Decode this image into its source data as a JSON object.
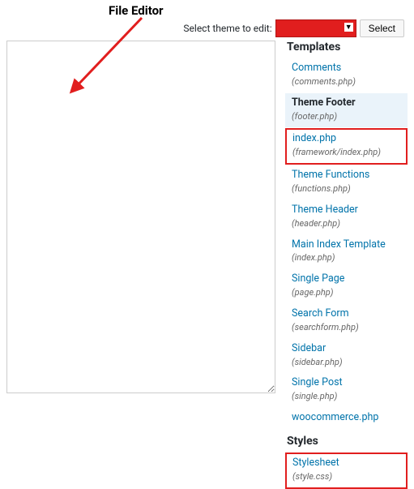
{
  "annotation": {
    "title": "File Editor"
  },
  "topbar": {
    "select_theme_label": "Select theme to edit:",
    "select_button": "Select"
  },
  "sidebar": {
    "templates_heading": "Templates",
    "styles_heading": "Styles",
    "templates": [
      {
        "name": "Comments",
        "path": "(comments.php)",
        "active": false,
        "boxed": false
      },
      {
        "name": "Theme Footer",
        "path": "(footer.php)",
        "active": true,
        "boxed": false
      },
      {
        "name": "index.php",
        "path": "(framework/index.php)",
        "active": false,
        "boxed": true
      },
      {
        "name": "Theme Functions",
        "path": "(functions.php)",
        "active": false,
        "boxed": false
      },
      {
        "name": "Theme Header",
        "path": "(header.php)",
        "active": false,
        "boxed": false
      },
      {
        "name": "Main Index Template",
        "path": "(index.php)",
        "active": false,
        "boxed": false
      },
      {
        "name": "Single Page",
        "path": "(page.php)",
        "active": false,
        "boxed": false
      },
      {
        "name": "Search Form",
        "path": "(searchform.php)",
        "active": false,
        "boxed": false
      },
      {
        "name": "Sidebar",
        "path": "(sidebar.php)",
        "active": false,
        "boxed": false
      },
      {
        "name": "Single Post",
        "path": "(single.php)",
        "active": false,
        "boxed": false
      },
      {
        "name": "woocommerce.php",
        "path": "",
        "active": false,
        "boxed": false
      }
    ],
    "styles": [
      {
        "name": "Stylesheet",
        "path": "(style.css)",
        "active": false,
        "boxed": true
      }
    ]
  }
}
